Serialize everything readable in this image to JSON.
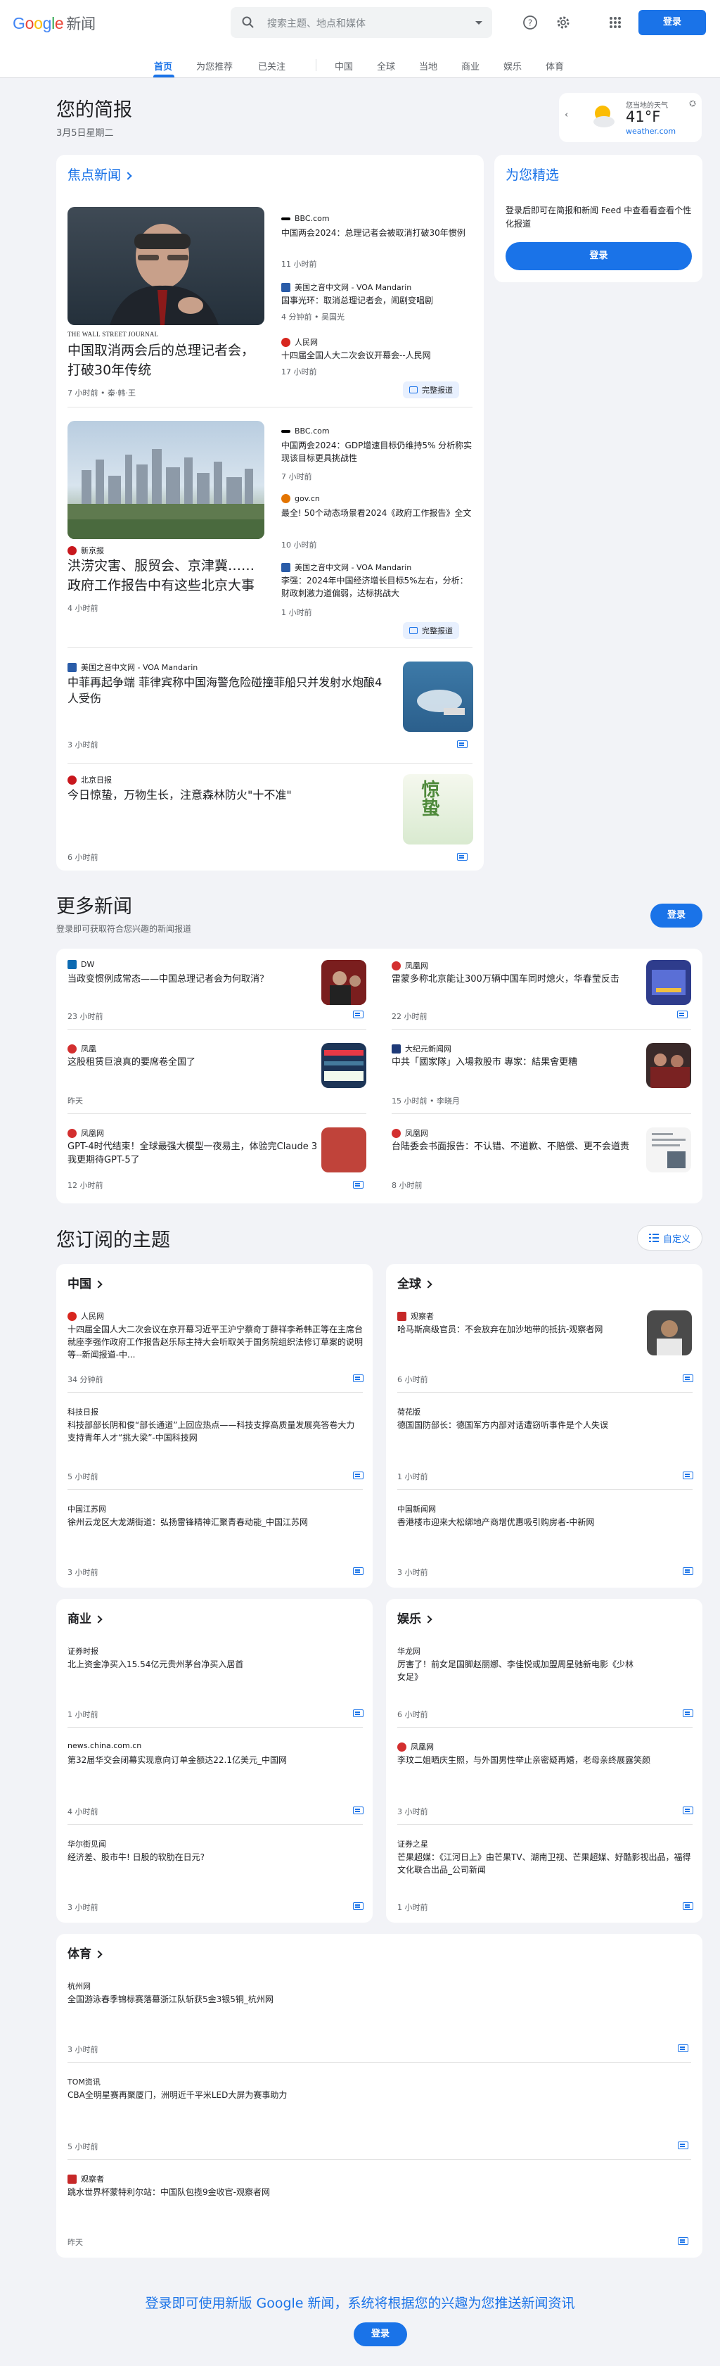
{
  "header": {
    "logo": {
      "g": "G",
      "o1": "o",
      "o2": "o",
      "g2": "g",
      "l": "l",
      "e": "e",
      "suffix": "新闻"
    },
    "search_placeholder": "搜索主题、地点和媒体",
    "signin": "登录"
  },
  "nav": [
    "首页",
    "为您推荐",
    "已关注",
    "中国",
    "全球",
    "当地",
    "商业",
    "娱乐",
    "体育"
  ],
  "briefing": {
    "title": "您的简报",
    "date": "3月5日星期二"
  },
  "weather": {
    "label": "您当地的天气",
    "temp": "41°F",
    "source": "weather.com"
  },
  "picks": {
    "title": "为您精选",
    "desc": "登录后即可在简报和新闻 Feed 中查看看查看个性化报道",
    "button": "登录"
  },
  "top": {
    "title": "焦点新闻",
    "s1": {
      "caption": "THE WALL STREET JOURNAL",
      "headline": "中国取消两会后的总理记者会，打破30年传统",
      "meta": "7 小时前 • 秦·韩·王",
      "related": [
        {
          "source": "BBC.com",
          "title": "中国两会2024：总理记者会被取消打破30年惯例",
          "meta": "11 小时前"
        },
        {
          "source": "美国之音中文网 - VOA Mandarin",
          "title": "国事光环：取消总理记者会，闹剧变唱剧",
          "meta": "4 分钟前 • 吴国光"
        },
        {
          "source": "人民网",
          "title": "十四届全国人大二次会议开幕会--人民网",
          "meta": "17 小时前"
        }
      ],
      "full": "完整报道"
    },
    "s2": {
      "source": "新京报",
      "headline": "洪涝灾害、服贸会、京津冀……政府工作报告中有这些北京大事",
      "meta": "4 小时前",
      "related": [
        {
          "source": "BBC.com",
          "title": "中国两会2024：GDP增速目标仍维持5% 分析称实现该目标更具挑战性",
          "meta": "7 小时前"
        },
        {
          "source": "gov.cn",
          "title": "最全! 50个动态场景看2024《政府工作报告》全文",
          "meta": "10 小时前"
        },
        {
          "source": "美国之音中文网 - VOA Mandarin",
          "title": "李强：2024年中国经济增长目标5%左右，分析：财政刺激力道偏弱，达标挑战大",
          "meta": "1 小时前"
        }
      ],
      "full": "完整报道"
    },
    "s3": {
      "source": "美国之音中文网 - VOA Mandarin",
      "headline": "中菲再起争端 菲律宾称中国海警危险碰撞菲船只并发射水炮酿4人受伤",
      "meta": "3 小时前"
    },
    "s4": {
      "source": "北京日报",
      "headline": "今日惊蛰，万物生长，注意森林防火\"十不准\"",
      "meta": "6 小时前",
      "img_text": "惊蛰"
    }
  },
  "more": {
    "title": "更多新闻",
    "sub": "登录即可获取符合您兴趣的新闻报道",
    "button": "登录",
    "items": [
      {
        "source": "DW",
        "title": "当政变惯例成常态——中国总理记者会为何取消？",
        "meta": "23 小时前"
      },
      {
        "source": "凤凰网",
        "title": "雷蒙多称北京能让300万辆中国车同时熄火，华春莹反击",
        "meta": "22 小时前"
      },
      {
        "source": "凤凰",
        "title": "这股租赁巨浪真的要席卷全国了",
        "meta": "昨天"
      },
      {
        "source": "大纪元新闻网",
        "title": "中共「國家隊」入場救股市 專家：結果會更糟",
        "meta": "15 小时前 • 李晓月"
      },
      {
        "source": "凤凰网",
        "title": "GPT-4时代结束！全球最强大模型一夜易主，体验完Claude 3我更期待GPT-5了",
        "meta": "12 小时前"
      },
      {
        "source": "凤凰网",
        "title": "台陆委会书面报告：不认错、不道歉、不赔偿、更不会道责",
        "meta": "8 小时前"
      }
    ]
  },
  "topics": {
    "title": "您订阅的主题",
    "customize": "自定义",
    "china": {
      "name": "中国",
      "items": [
        {
          "source": "人民网",
          "title": "十四届全国人大二次会议在京开幕习近平王沪宁蔡奇丁薛祥李希韩正等在主席台就座李强作政府工作报告赵乐际主持大会听取关于国务院组织法修订草案的说明等--新闻报道-中...",
          "meta": "34 分钟前"
        },
        {
          "source": "科技日报",
          "title": "科技部部长阴和俊“部长通道”上回应热点——科技支撑高质量发展亮答卷大力支持青年人才“挑大梁”-中国科技网",
          "meta": "5 小时前"
        },
        {
          "source": "中国江苏网",
          "title": "徐州云龙区大龙湖街道：弘扬雷锋精神汇聚青春动能_中国江苏网",
          "meta": "3 小时前"
        }
      ]
    },
    "world": {
      "name": "全球",
      "items": [
        {
          "source": "观察者",
          "title": "哈马斯高级官员：不会放弃在加沙地带的抵抗-观察者网",
          "meta": "6 小时前"
        },
        {
          "source": "荷花版",
          "title": "德国国防部长：德国军方内部对话遭窃听事件是个人失误",
          "meta": "1 小时前"
        },
        {
          "source": "中国新闻网",
          "title": "香港楼市迎来大松绑地产商增优惠吸引购房者-中新网",
          "meta": "3 小时前"
        }
      ]
    },
    "business": {
      "name": "商业",
      "items": [
        {
          "source": "证券时报",
          "title": "北上资金净买入15.54亿元贵州茅台净买入居首",
          "meta": "1 小时前"
        },
        {
          "source": "news.china.com.cn",
          "title": "第32届华交会闭幕实现意向订单金额达22.1亿美元_中国网",
          "meta": "4 小时前"
        },
        {
          "source": "华尔街见闻",
          "title": "经济差、股市牛! 日股的软肋在日元?",
          "meta": "3 小时前"
        }
      ]
    },
    "ent": {
      "name": "娱乐",
      "items": [
        {
          "source": "华龙网",
          "title": "厉害了！前女足国脚赵丽娜、李佳悦或加盟周星驰新电影《少林女足》",
          "meta": "6 小时前"
        },
        {
          "source": "凤凰网",
          "title": "李玟二姐晒庆生照，与外国男性举止亲密疑再婚，老母亲终展露笑颜",
          "meta": "3 小时前"
        },
        {
          "source": "证券之星",
          "title": "芒果超媒：《江河日上》由芒果TV、湖南卫视、芒果超媒、好酷影视出品，福得文化联合出品_公司新闻",
          "meta": "1 小时前"
        }
      ]
    },
    "sports": {
      "name": "体育",
      "items": [
        {
          "source": "杭州网",
          "title": "全国游泳春季锦标赛落幕浙江队斩获5金3银5铜_杭州网",
          "meta": "3 小时前"
        },
        {
          "source": "TOM资讯",
          "title": "CBA全明星赛再聚厦门，洲明近千平米LED大屏为赛事助力",
          "meta": "5 小时前"
        },
        {
          "source": "观察者",
          "title": "跳水世界杯蒙特利尔站：中国队包揽9金收官-观察者网",
          "meta": "昨天"
        }
      ]
    }
  },
  "footer": {
    "text": "登录即可使用新版 Google 新闻，系统将根据您的兴趣为您推送新闻资讯",
    "button": "登录"
  }
}
